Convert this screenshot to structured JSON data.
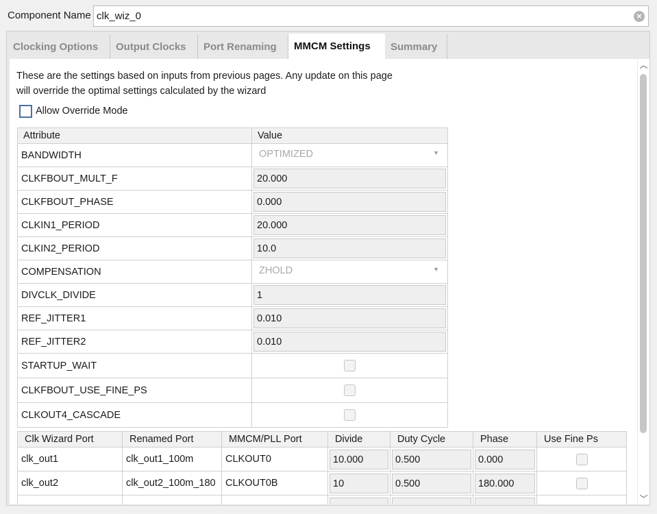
{
  "component": {
    "label": "Component Name",
    "value": "clk_wiz_0"
  },
  "tabs": [
    {
      "label": "Clocking Options",
      "active": false
    },
    {
      "label": "Output Clocks",
      "active": false
    },
    {
      "label": "Port Renaming",
      "active": false
    },
    {
      "label": "MMCM Settings",
      "active": true
    },
    {
      "label": "Summary",
      "active": false
    }
  ],
  "description": {
    "line1": "These are the settings based on inputs from previous pages. Any update on this page",
    "line2": "will override the optimal settings calculated by the wizard"
  },
  "override": {
    "label": "Allow Override Mode",
    "checked": false
  },
  "attributes": {
    "headers": {
      "attribute": "Attribute",
      "value": "Value"
    },
    "rows": [
      {
        "name": "BANDWIDTH",
        "kind": "select",
        "value": "OPTIMIZED"
      },
      {
        "name": "CLKFBOUT_MULT_F",
        "kind": "input",
        "value": "20.000"
      },
      {
        "name": "CLKFBOUT_PHASE",
        "kind": "input",
        "value": "0.000"
      },
      {
        "name": "CLKIN1_PERIOD",
        "kind": "input",
        "value": "20.000"
      },
      {
        "name": "CLKIN2_PERIOD",
        "kind": "input",
        "value": "10.0"
      },
      {
        "name": "COMPENSATION",
        "kind": "select",
        "value": "ZHOLD"
      },
      {
        "name": "DIVCLK_DIVIDE",
        "kind": "input",
        "value": "1"
      },
      {
        "name": "REF_JITTER1",
        "kind": "input",
        "value": "0.010"
      },
      {
        "name": "REF_JITTER2",
        "kind": "input",
        "value": "0.010"
      },
      {
        "name": "STARTUP_WAIT",
        "kind": "checkbox",
        "value": false
      },
      {
        "name": "CLKFBOUT_USE_FINE_PS",
        "kind": "checkbox",
        "value": false
      },
      {
        "name": "CLKOUT4_CASCADE",
        "kind": "checkbox",
        "value": false
      }
    ]
  },
  "ports": {
    "headers": [
      "Clk Wizard Port",
      "Renamed Port",
      "MMCM/PLL Port",
      "Divide",
      "Duty Cycle",
      "Phase",
      "Use Fine Ps"
    ],
    "rows": [
      {
        "wizard_port": "clk_out1",
        "renamed": "clk_out1_100m",
        "mmcm_port": "CLKOUT0",
        "divide": "10.000",
        "duty": "0.500",
        "phase": "0.000",
        "fine_ps": false
      },
      {
        "wizard_port": "clk_out2",
        "renamed": "clk_out2_100m_180",
        "mmcm_port": "CLKOUT0B",
        "divide": "10",
        "duty": "0.500",
        "phase": "180.000",
        "fine_ps": false
      }
    ]
  }
}
